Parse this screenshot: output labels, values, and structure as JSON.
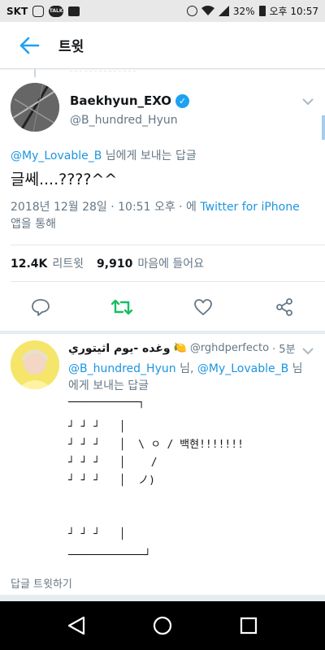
{
  "status_bar": {
    "carrier": "SKT",
    "talk_label": "TALK",
    "battery": "32%",
    "time": "오후 10:57"
  },
  "header": {
    "title": "트윗"
  },
  "tweet": {
    "user_name": "Baekhyun_EXO",
    "user_handle": "@B_hundred_Hyun",
    "reply_to_handle": "@My_Lovable_B",
    "reply_to_suffix": " 님에게 보내는 답글",
    "text": "글쎄....????^^",
    "date": "2018년 12월 28일 · 10:51 오후 · 에 ",
    "source": "Twitter for iPhone",
    "source_suffix": " 앱을 통해",
    "retweet_count": "12.4K",
    "retweet_label": "리트윗",
    "like_count": "9,910",
    "like_label": "마음에 들어요"
  },
  "reply": {
    "name": "وغده -يوم اثيتوري",
    "emoji": "🍋",
    "handle": "@rghdperfecto",
    "time": "· 5분",
    "to_handle_1": "@B_hundred_Hyun",
    "to_sep": " 님, ",
    "to_handle_2": "@My_Lovable_B",
    "to_suffix": " 님에게 보내는 답글",
    "ascii_top": "───────────┐",
    "ascii_row_1": "┘ ┘ ┘   │",
    "ascii_row_2": "┘ ┘ ┘   │  \\ ㅇ / 백현!!!!!!!",
    "ascii_row_3": "┘ ┘ ┘   │    /",
    "ascii_row_4": "┘ ┘ ┘   │  ノ)",
    "ascii_row_5": "┘ ┘ ┘   │",
    "ascii_bottom": "────────────┘",
    "reply_action": "답글 트윗하기"
  },
  "colors": {
    "twitter_blue": "#1da1f2",
    "retweet_green": "#17bf63",
    "text_gray": "#657786"
  }
}
